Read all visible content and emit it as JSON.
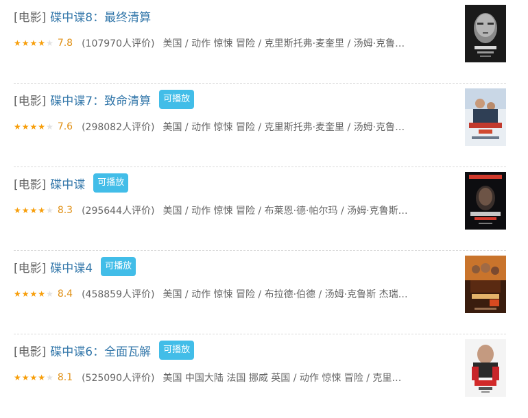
{
  "results": [
    {
      "type_tag": "[电影]",
      "title": "碟中谍8：最终清算",
      "playable": false,
      "play_label": "",
      "stars": 4,
      "rating": "7.8",
      "votes": "(107970人评价)",
      "subject": "美国 / 动作 惊悚 冒险 / 克里斯托弗·麦奎里 / 汤姆·克鲁…"
    },
    {
      "type_tag": "[电影]",
      "title": "碟中谍7：致命清算",
      "playable": true,
      "play_label": "可播放",
      "stars": 4,
      "rating": "7.6",
      "votes": "(298082人评价)",
      "subject": "美国 / 动作 惊悚 冒险 / 克里斯托弗·麦奎里 / 汤姆·克鲁…"
    },
    {
      "type_tag": "[电影]",
      "title": "碟中谍",
      "playable": true,
      "play_label": "可播放",
      "stars": 4,
      "rating": "8.3",
      "votes": "(295644人评价)",
      "subject": "美国 / 动作 惊悚 冒险 / 布莱恩·德·帕尔玛 / 汤姆·克鲁斯…"
    },
    {
      "type_tag": "[电影]",
      "title": "碟中谍4",
      "playable": true,
      "play_label": "可播放",
      "stars": 4,
      "rating": "8.4",
      "votes": "(458859人评价)",
      "subject": "美国 / 动作 惊悚 冒险 / 布拉德·伯德 / 汤姆·克鲁斯 杰瑞…"
    },
    {
      "type_tag": "[电影]",
      "title": "碟中谍6：全面瓦解",
      "playable": true,
      "play_label": "可播放",
      "stars": 4,
      "rating": "8.1",
      "votes": "(525090人评价)",
      "subject": "美国 中国大陆 法国 挪威 英国 / 动作 惊悚 冒险 / 克里…"
    }
  ],
  "colors": {
    "title_link": "#3377aa",
    "play_badge": "#42bde8",
    "rating": "#e09015",
    "star_on": "#f79e0a",
    "star_off": "#e2e2e2"
  }
}
